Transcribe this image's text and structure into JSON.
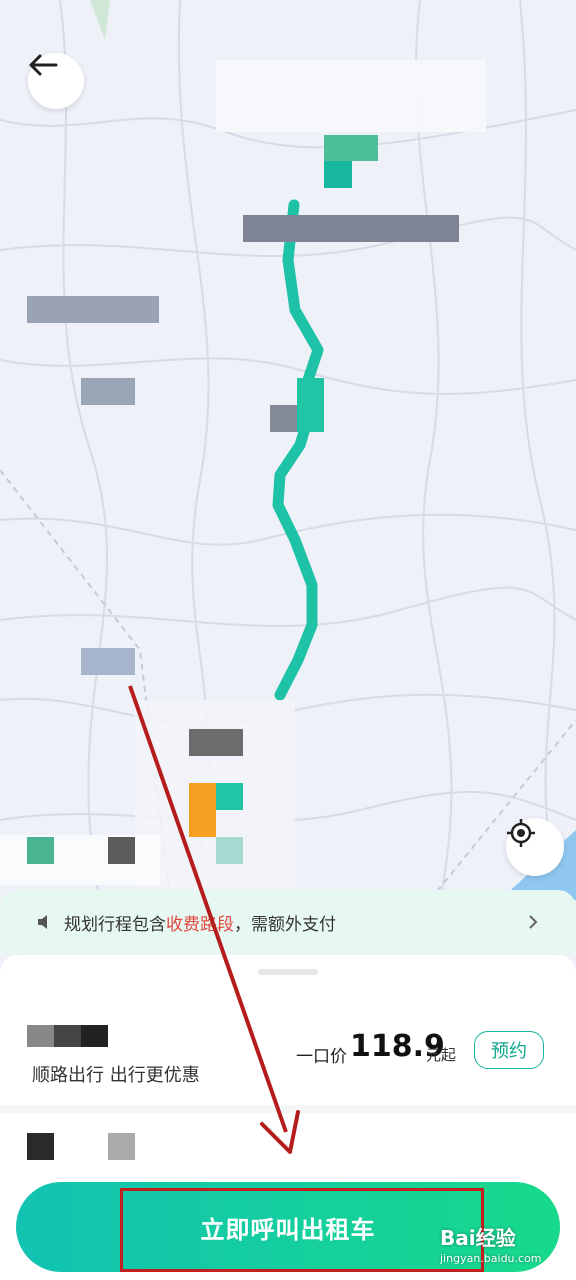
{
  "toll_notice": {
    "before": "规划行程包含",
    "highlight": "收费路段",
    "after": "，需额外支付"
  },
  "ride_option": {
    "subtitle": "顺路出行 出行更优惠",
    "price_prefix": "一口价",
    "price": "118.9",
    "price_suffix": "元起",
    "reserve_label": "预约"
  },
  "cta": {
    "label": "立即呼叫出租车"
  },
  "watermark": {
    "brand": "Bai经验",
    "url": "jingyan.baidu.com"
  },
  "colors": {
    "route": "#1ec2a6",
    "accent": "#17b59b",
    "highlight_box": "#c41f1f",
    "toll_text": "#e2473d"
  },
  "icons": {
    "back": "arrow-left-icon",
    "locate": "locate-crosshair-icon",
    "speaker": "speaker-icon",
    "chevron": "chevron-right-icon"
  }
}
